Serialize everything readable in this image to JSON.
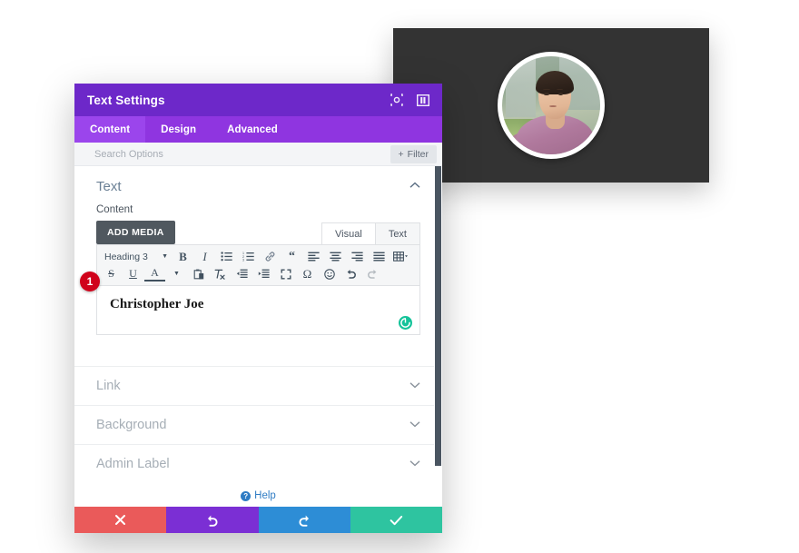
{
  "preview": {
    "name": "avatar-preview-card",
    "background_color": "#333333",
    "avatar_alt": "person-portrait"
  },
  "modal": {
    "title": "Text Settings",
    "header_icons": [
      {
        "name": "target-icon",
        "label": "Reposition"
      },
      {
        "name": "layout-panel-icon",
        "label": "Dock Panel"
      }
    ],
    "tabs": [
      {
        "label": "Content",
        "active": true
      },
      {
        "label": "Design",
        "active": false
      },
      {
        "label": "Advanced",
        "active": false
      }
    ],
    "search": {
      "placeholder": "Search Options",
      "value": ""
    },
    "filter_button": {
      "label": "Filter",
      "plus": "+"
    },
    "sections": {
      "text": {
        "title": "Text",
        "chevron": "⌃",
        "content_label": "Content",
        "add_media_label": "ADD MEDIA",
        "editor_tabs": [
          {
            "label": "Visual",
            "active": true
          },
          {
            "label": "Text",
            "active": false
          }
        ],
        "toolbar": {
          "format_select": "Heading 3",
          "row1": [
            {
              "name": "bold-icon",
              "glyph": "B"
            },
            {
              "name": "italic-icon",
              "glyph": "I"
            },
            {
              "name": "bulleted-list-icon",
              "glyph": ""
            },
            {
              "name": "numbered-list-icon",
              "glyph": ""
            },
            {
              "name": "link-icon",
              "glyph": ""
            },
            {
              "name": "blockquote-icon",
              "glyph": "❝"
            },
            {
              "name": "align-left-icon",
              "glyph": ""
            },
            {
              "name": "align-center-icon",
              "glyph": ""
            },
            {
              "name": "align-right-icon",
              "glyph": ""
            },
            {
              "name": "align-justify-icon",
              "glyph": ""
            },
            {
              "name": "table-icon",
              "glyph": ""
            }
          ],
          "row2": [
            {
              "name": "strikethrough-icon",
              "glyph": "S"
            },
            {
              "name": "underline-icon",
              "glyph": "U"
            },
            {
              "name": "text-color-icon",
              "glyph": "A"
            },
            {
              "name": "paste-as-text-icon",
              "glyph": ""
            },
            {
              "name": "clear-formatting-icon",
              "glyph": ""
            },
            {
              "name": "decrease-indent-icon",
              "glyph": ""
            },
            {
              "name": "increase-indent-icon",
              "glyph": ""
            },
            {
              "name": "fullscreen-icon",
              "glyph": ""
            },
            {
              "name": "special-character-icon",
              "glyph": "Ω"
            },
            {
              "name": "emoji-icon",
              "glyph": "☺"
            },
            {
              "name": "undo-icon",
              "glyph": "↶"
            },
            {
              "name": "redo-icon",
              "glyph": "↷"
            }
          ]
        },
        "editor_value": "Christopher Joe",
        "step_badge": "1",
        "grammar_indicator": "G"
      },
      "collapsed": [
        {
          "title": "Link",
          "chevron": "⌄"
        },
        {
          "title": "Background",
          "chevron": "⌄"
        },
        {
          "title": "Admin Label",
          "chevron": "⌄"
        }
      ]
    },
    "help": {
      "label": "Help",
      "icon_glyph": "?"
    },
    "actions": [
      {
        "name": "cancel-button",
        "icon": "close-icon",
        "color": "#ea5a5a"
      },
      {
        "name": "undo-button",
        "icon": "undo-icon",
        "color": "#7b2fd4"
      },
      {
        "name": "redo-button",
        "icon": "redo-icon",
        "color": "#2d8dd6"
      },
      {
        "name": "save-button",
        "icon": "check-icon",
        "color": "#2ec4a0"
      }
    ]
  },
  "colors": {
    "header_purple": "#6d28c9",
    "tabbar_purple": "#8f35e0",
    "active_tab_purple": "#9b45ec",
    "badge_red": "#d0021b",
    "teal": "#15c39a"
  }
}
